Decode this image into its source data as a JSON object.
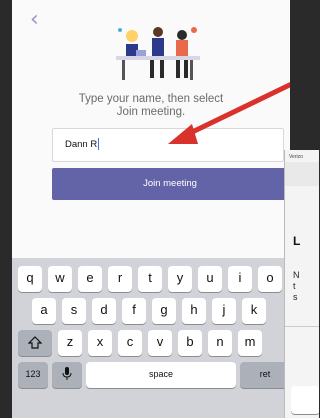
{
  "nav": {
    "back_glyph": "‹"
  },
  "join": {
    "prompt_line1": "Type your name, then select",
    "prompt_line2": "Join meeting.",
    "name_value": "Dann R",
    "join_label": "Join meeting"
  },
  "colors": {
    "accent": "#6264a7",
    "arrow": "#d9312b",
    "keyboard_bg": "#d1d3d9"
  },
  "keyboard": {
    "row1": [
      "q",
      "w",
      "e",
      "r",
      "t",
      "y",
      "u",
      "i",
      "o"
    ],
    "row2": [
      "a",
      "s",
      "d",
      "f",
      "g",
      "h",
      "j",
      "k"
    ],
    "shift_icon": "shift-icon",
    "row3": [
      "z",
      "x",
      "c",
      "v",
      "b",
      "n",
      "m"
    ],
    "numbers_label": "123",
    "mic_icon": "microphone-icon",
    "space_label": "space",
    "return_label": "ret"
  },
  "second_screen": {
    "status": "Verizo",
    "title_fragment": "L",
    "body_fragment_1": "N",
    "body_fragment_2": "t",
    "body_fragment_3": "s"
  }
}
